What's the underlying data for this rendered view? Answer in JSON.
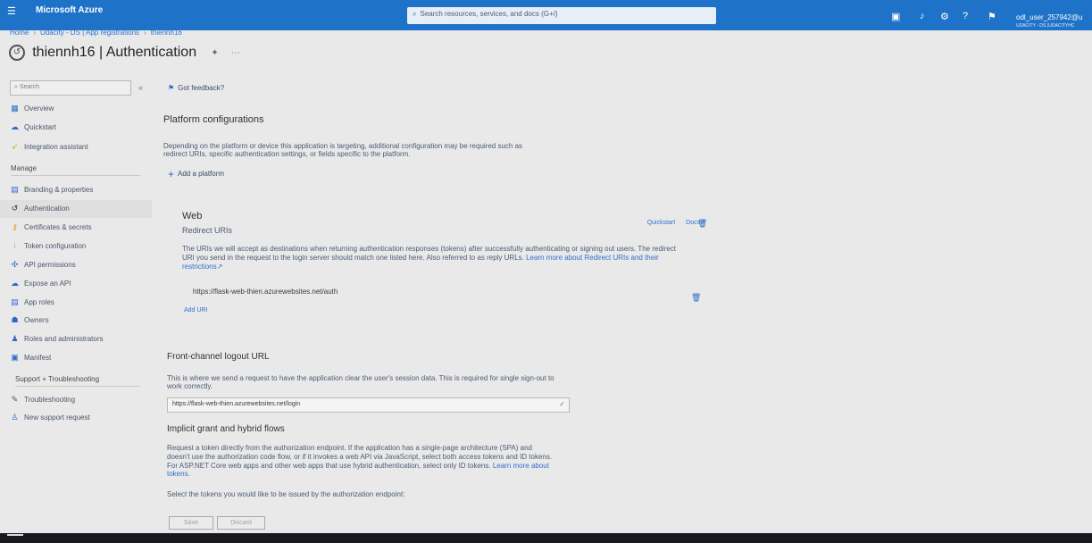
{
  "topbar": {
    "menu_icon": "hamburger-icon",
    "brand": "Microsoft Azure",
    "search_placeholder": "Search resources, services, and docs (G+/)",
    "user": "odl_user_257942@u",
    "tenant": "UDACITY - DS (UDACITYHC"
  },
  "breadcrumb": [
    "Home",
    "Udacity - DS | App registrations",
    "thiennh16"
  ],
  "page_title": "thiennh16 | Authentication",
  "sidebar": {
    "search_placeholder": "Search",
    "items_top": [
      "Overview",
      "Quickstart",
      "Integration assistant"
    ],
    "manage_label": "Manage",
    "manage_items": [
      "Branding & properties",
      "Authentication",
      "Certificates & secrets",
      "Token configuration",
      "API permissions",
      "Expose an API",
      "App roles",
      "Owners",
      "Roles and administrators",
      "Manifest"
    ],
    "support_label": "Support + Troubleshooting",
    "support_items": [
      "Troubleshooting",
      "New support request"
    ]
  },
  "main": {
    "feedback": "Got feedback?",
    "platform_title": "Platform configurations",
    "platform_desc_1": "Depending on the platform or device this application is targeting, additional configuration may be required such as",
    "platform_desc_2": "redirect URIs, specific authentication settings, or fields specific to the platform.",
    "add_platform": "Add a platform",
    "web_title": "Web",
    "redirect_title": "Redirect URIs",
    "quickstart_link": "Quickstart",
    "docs_link": "Docs",
    "redirect_desc_1": "The URIs we will accept as destinations when returning authentication responses (tokens) after successfully authenticating or signing out users. The redirect",
    "redirect_desc_2": "URI you send in the request to the login server should match one listed here. Also referred to as reply URLs.",
    "redirect_learn": "Learn more about Redirect URIs and their",
    "restrictions": "restrictions",
    "redirect_uri": "https://flask-web-thien.azurewebsites.net/auth",
    "add_uri": "Add URI",
    "logout_title": "Front-channel logout URL",
    "logout_desc_1": "This is where we send a request to have the application clear the user's session data. This is required for single sign-out to",
    "logout_desc_2": "work correctly.",
    "logout_url": "https://flask-web-thien.azurewebsites.net/login",
    "implicit_title": "Implicit grant and hybrid flows",
    "implicit_desc_1": "Request a token directly from the authorization endpoint. If the application has a single-page architecture (SPA) and",
    "implicit_desc_2": "doesn't use the authorization code flow, or if it invokes a web API via JavaScript, select both access tokens and ID tokens.",
    "implicit_desc_3": "For ASP.NET Core web apps and other web apps that use hybrid authentication, select only ID tokens.",
    "implicit_learn": "Learn more about",
    "implicit_learn_2": "tokens.",
    "select_tokens": "Select the tokens you would like to be issued by the authorization endpoint:",
    "save": "Save",
    "discard": "Discard"
  }
}
